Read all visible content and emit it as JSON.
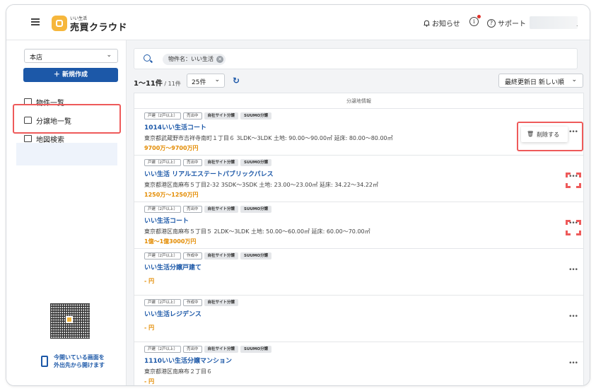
{
  "header": {
    "logo_sub": "いい生活",
    "logo_main": "売買クラウド",
    "notice_label": "お知らせ",
    "info_icon": "i",
    "support_label": "サポート"
  },
  "sidebar": {
    "store_select": "本店",
    "new_button": "＋ 新規作成",
    "items": [
      {
        "label": "物件一覧"
      },
      {
        "label": "分譲地一覧"
      },
      {
        "label": "地図検索"
      }
    ],
    "qr_text_1": "今開いている画面を",
    "qr_text_2": "外出先から開けます"
  },
  "main": {
    "search_chip": "物件名：いい生活",
    "count_label": "1〜11件",
    "count_total": " / 11件",
    "per_page": "25件",
    "sort": "最終更新日 新しい順",
    "list_header": "分譲地情報",
    "delete_label": "削除する",
    "rows": [
      {
        "tags": [
          "戸建（2戸以上）",
          "売出中",
          "自社サイト分譲",
          "SUUMO分譲"
        ],
        "name": "1014いい生活コート",
        "addr": "東京都武蔵野市吉祥寺南町１丁目６  3LDK〜3LDK 土地: 90.00〜90.00㎡ 延床: 80.00〜80.00㎡",
        "price": "9700万〜9700万円"
      },
      {
        "tags": [
          "戸建（2戸以上）",
          "売出中",
          "自社サイト分譲",
          "SUUMO分譲"
        ],
        "name": "いい生活 リアルエステートパブリックパレス",
        "addr": "東京都港区南麻布５丁目2-32  3SDK〜3SDK 土地: 23.00〜23.00㎡ 延床: 34.22〜34.22㎡",
        "price": "1250万〜1250万円"
      },
      {
        "tags": [
          "戸建（2戸以上）",
          "売出中",
          "自社サイト分譲",
          "SUUMO分譲"
        ],
        "name": "いい生活コート",
        "addr": "東京都港区南麻布５丁目５  2LDK〜3LDK 土地: 50.00〜60.00㎡ 延床: 60.00〜70.00㎡",
        "price": "1億〜1億3000万円"
      },
      {
        "tags": [
          "戸建（2戸以上）",
          "作成中",
          "自社サイト分譲",
          "SUUMO分譲"
        ],
        "name": "いい生活分譲戸建て",
        "addr": "",
        "price": "- 円"
      },
      {
        "tags": [
          "戸建（2戸以上）",
          "作成中",
          "自社サイト分譲"
        ],
        "name": "いい生活レジデンス",
        "addr": "",
        "price": "- 円"
      },
      {
        "tags": [
          "戸建（2戸以上）",
          "売出中",
          "自社サイト分譲",
          "SUUMO分譲"
        ],
        "name": "1110いい生活分譲マンション",
        "addr": "東京都港区南麻布２丁目６",
        "price": "- 円"
      }
    ]
  },
  "colors": {
    "accent": "#1c58a8",
    "highlight": "#ee5a5a",
    "price": "#e38b00"
  }
}
